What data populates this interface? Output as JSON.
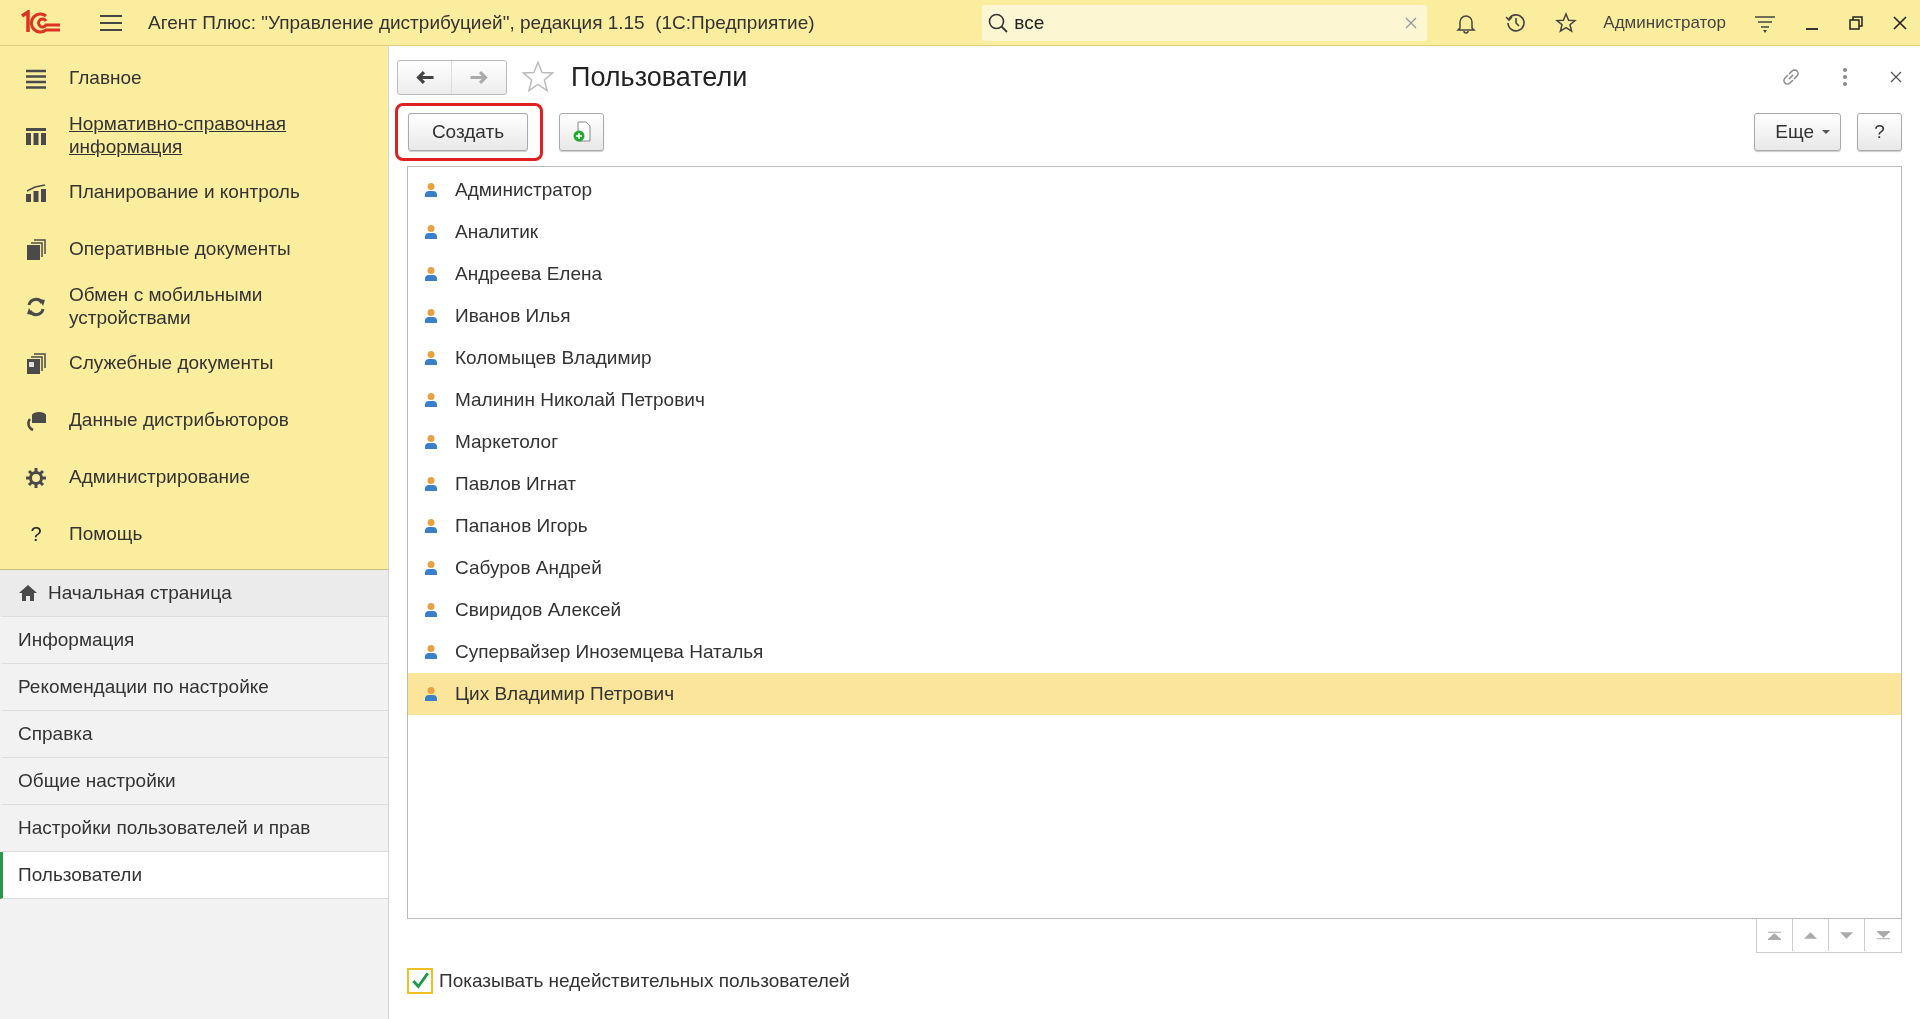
{
  "window": {
    "title": "Агент Плюс: \"Управление дистрибуцией\", редакция 1.15  (1С:Предприятие)",
    "search_value": "все",
    "user": "Администратор"
  },
  "sections": [
    {
      "label": "Главное",
      "underlined": false
    },
    {
      "label": "Нормативно-справочная информация",
      "underlined": true
    },
    {
      "label": "Планирование и контроль",
      "underlined": false
    },
    {
      "label": "Оперативные документы",
      "underlined": false
    },
    {
      "label": "Обмен с мобильными устройствами",
      "underlined": false
    },
    {
      "label": "Служебные документы",
      "underlined": false
    },
    {
      "label": "Данные дистрибьюторов",
      "underlined": false
    },
    {
      "label": "Администрирование",
      "underlined": false
    },
    {
      "label": "Помощь",
      "underlined": false,
      "glyph": "?"
    }
  ],
  "open_pages": [
    {
      "label": "Начальная страница",
      "kind": "home",
      "selected": false
    },
    {
      "label": "Информация",
      "kind": "page",
      "selected": false
    },
    {
      "label": "Рекомендации по настройке",
      "kind": "page",
      "selected": false
    },
    {
      "label": "Справка",
      "kind": "page",
      "selected": false
    },
    {
      "label": "Общие настройки",
      "kind": "page",
      "selected": false
    },
    {
      "label": "Настройки пользователей и прав",
      "kind": "page",
      "selected": false
    },
    {
      "label": "Пользователи",
      "kind": "page",
      "selected": true
    }
  ],
  "form": {
    "title": "Пользователи",
    "create_button": "Создать",
    "more_button": "Еще",
    "help_button": "?",
    "rows": [
      {
        "name": "Администратор",
        "selected": false
      },
      {
        "name": "Аналитик",
        "selected": false
      },
      {
        "name": "Андреева Елена",
        "selected": false
      },
      {
        "name": "Иванов Илья",
        "selected": false
      },
      {
        "name": "Коломыцев Владимир",
        "selected": false
      },
      {
        "name": "Малинин Николай Петрович",
        "selected": false
      },
      {
        "name": "Маркетолог",
        "selected": false
      },
      {
        "name": "Павлов Игнат",
        "selected": false
      },
      {
        "name": "Папанов Игорь",
        "selected": false
      },
      {
        "name": "Сабуров Андрей",
        "selected": false
      },
      {
        "name": "Свиридов Алексей",
        "selected": false
      },
      {
        "name": "Супервайзер Иноземцева Наталья",
        "selected": false
      },
      {
        "name": "Цих Владимир Петрович",
        "selected": true
      }
    ],
    "show_invalid": {
      "label": "Показывать недействительных пользователей",
      "checked": true
    }
  }
}
